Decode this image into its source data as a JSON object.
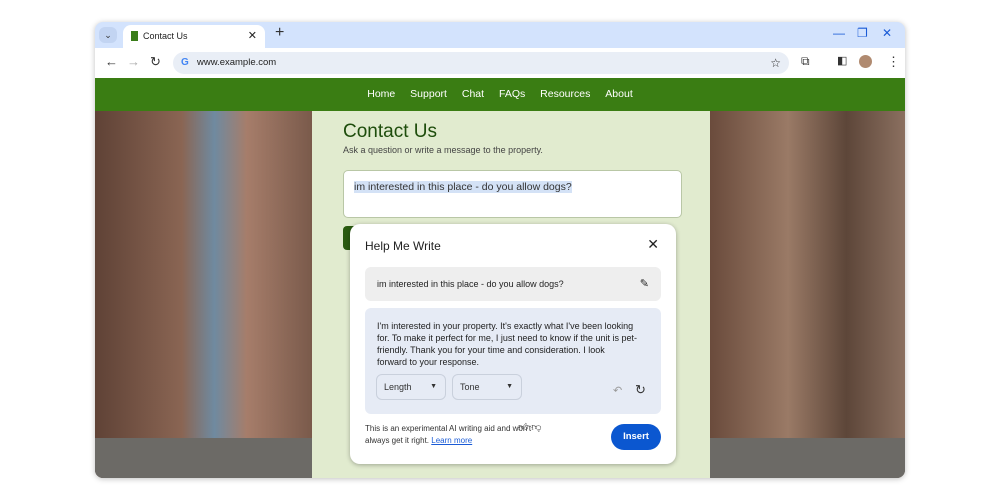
{
  "browser": {
    "tab_title": "Contact Us",
    "url": "www.example.com",
    "accent": "#0b57d0"
  },
  "nav": {
    "items": [
      "Home",
      "Support",
      "Chat",
      "FAQs",
      "Resources",
      "About"
    ],
    "color": "#3a7d13"
  },
  "page": {
    "title": "Contact Us",
    "subtitle": "Ask a question or write a message to the property.",
    "message": "im interested in this place - do you allow dogs?"
  },
  "dialog": {
    "title": "Help Me Write",
    "prompt": "im interested in this place - do you allow dogs?",
    "response": "I'm interested in your property. It's exactly what I've been looking for. To make it perfect for me, I just need to know if the unit is pet-friendly. Thank you for your time and consideration. I look forward to your response.",
    "length_label": "Length",
    "tone_label": "Tone",
    "disclaimer": "This is an experimental AI writing aid and won't always get it right.",
    "learn_more": "Learn more",
    "insert_label": "Insert"
  }
}
